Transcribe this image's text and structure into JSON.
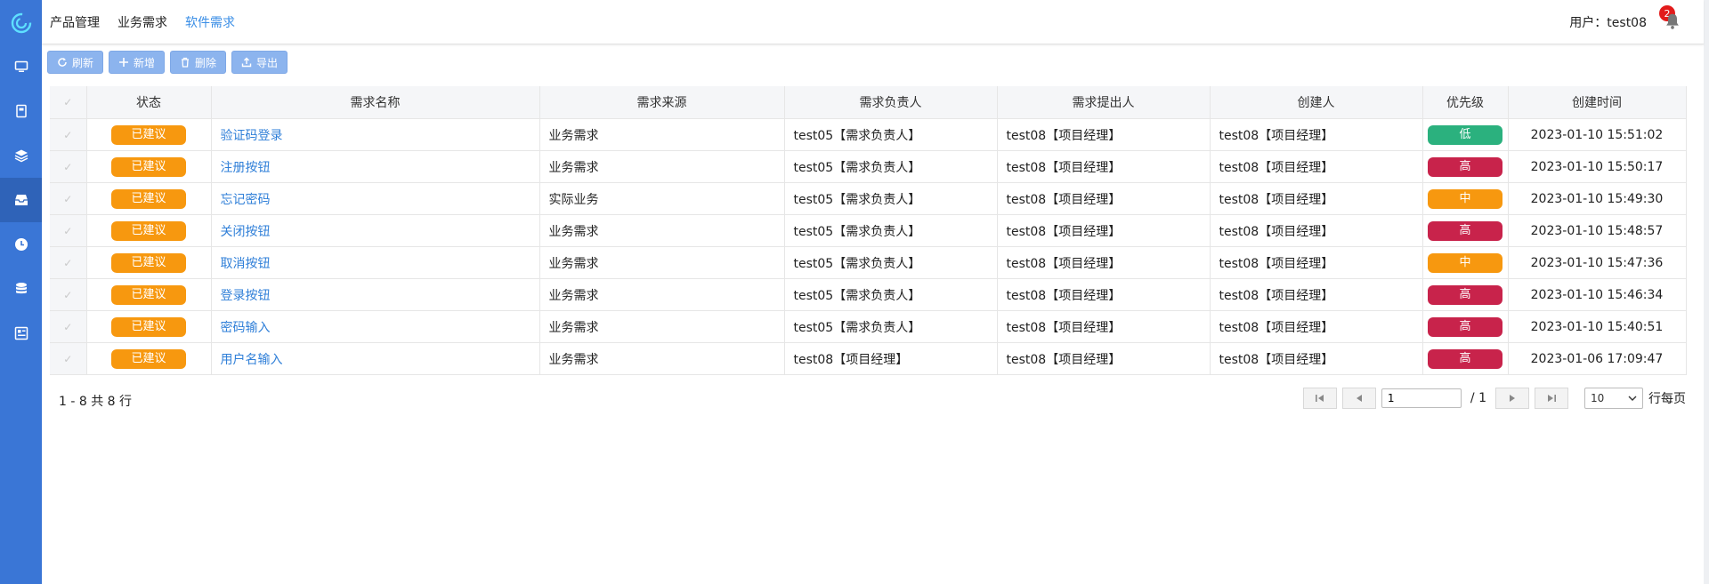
{
  "nav": {
    "items": [
      {
        "label": "产品管理"
      },
      {
        "label": "业务需求"
      },
      {
        "label": "软件需求"
      }
    ],
    "user_label": "用户：test08",
    "notification_count": "2"
  },
  "toolbar": {
    "refresh": "刷新",
    "add": "新增",
    "delete": "删除",
    "export": "导出"
  },
  "table": {
    "headers": [
      "状态",
      "需求名称",
      "需求来源",
      "需求负责人",
      "需求提出人",
      "创建人",
      "优先级",
      "创建时间"
    ],
    "rows": [
      {
        "status": "已建议",
        "name": "验证码登录",
        "source": "业务需求",
        "owner": "test05【需求负责人】",
        "proposer": "test08【项目经理】",
        "creator": "test08【项目经理】",
        "priority": "低",
        "time": "2023-01-10 15:51:02"
      },
      {
        "status": "已建议",
        "name": "注册按钮",
        "source": "业务需求",
        "owner": "test05【需求负责人】",
        "proposer": "test08【项目经理】",
        "creator": "test08【项目经理】",
        "priority": "高",
        "time": "2023-01-10 15:50:17"
      },
      {
        "status": "已建议",
        "name": "忘记密码",
        "source": "实际业务",
        "owner": "test05【需求负责人】",
        "proposer": "test08【项目经理】",
        "creator": "test08【项目经理】",
        "priority": "中",
        "time": "2023-01-10 15:49:30"
      },
      {
        "status": "已建议",
        "name": "关闭按钮",
        "source": "业务需求",
        "owner": "test05【需求负责人】",
        "proposer": "test08【项目经理】",
        "creator": "test08【项目经理】",
        "priority": "高",
        "time": "2023-01-10 15:48:57"
      },
      {
        "status": "已建议",
        "name": "取消按钮",
        "source": "业务需求",
        "owner": "test05【需求负责人】",
        "proposer": "test08【项目经理】",
        "creator": "test08【项目经理】",
        "priority": "中",
        "time": "2023-01-10 15:47:36"
      },
      {
        "status": "已建议",
        "name": "登录按钮",
        "source": "业务需求",
        "owner": "test05【需求负责人】",
        "proposer": "test08【项目经理】",
        "creator": "test08【项目经理】",
        "priority": "高",
        "time": "2023-01-10 15:46:34"
      },
      {
        "status": "已建议",
        "name": "密码输入",
        "source": "业务需求",
        "owner": "test05【需求负责人】",
        "proposer": "test08【项目经理】",
        "creator": "test08【项目经理】",
        "priority": "高",
        "time": "2023-01-10 15:40:51"
      },
      {
        "status": "已建议",
        "name": "用户名输入",
        "source": "业务需求",
        "owner": "test08【项目经理】",
        "proposer": "test08【项目经理】",
        "creator": "test08【项目经理】",
        "priority": "高",
        "time": "2023-01-06 17:09:47"
      }
    ]
  },
  "pager": {
    "info": "1 - 8 共 8 行",
    "page_value": "1",
    "total_pages": "/ 1",
    "page_size": "10",
    "per_page_label": "行每页"
  },
  "colors": {
    "sidebar": "#3a76d6",
    "status_orange": "#f7980f",
    "priority_low": "#2bb17e",
    "priority_mid": "#f7980f",
    "priority_high": "#c8234b",
    "link": "#2f7fd8"
  },
  "icons": {
    "sidebar": [
      "monitor-icon",
      "book-icon",
      "layers-icon",
      "inbox-icon",
      "clock-icon",
      "database-icon",
      "dashboard-icon"
    ]
  }
}
